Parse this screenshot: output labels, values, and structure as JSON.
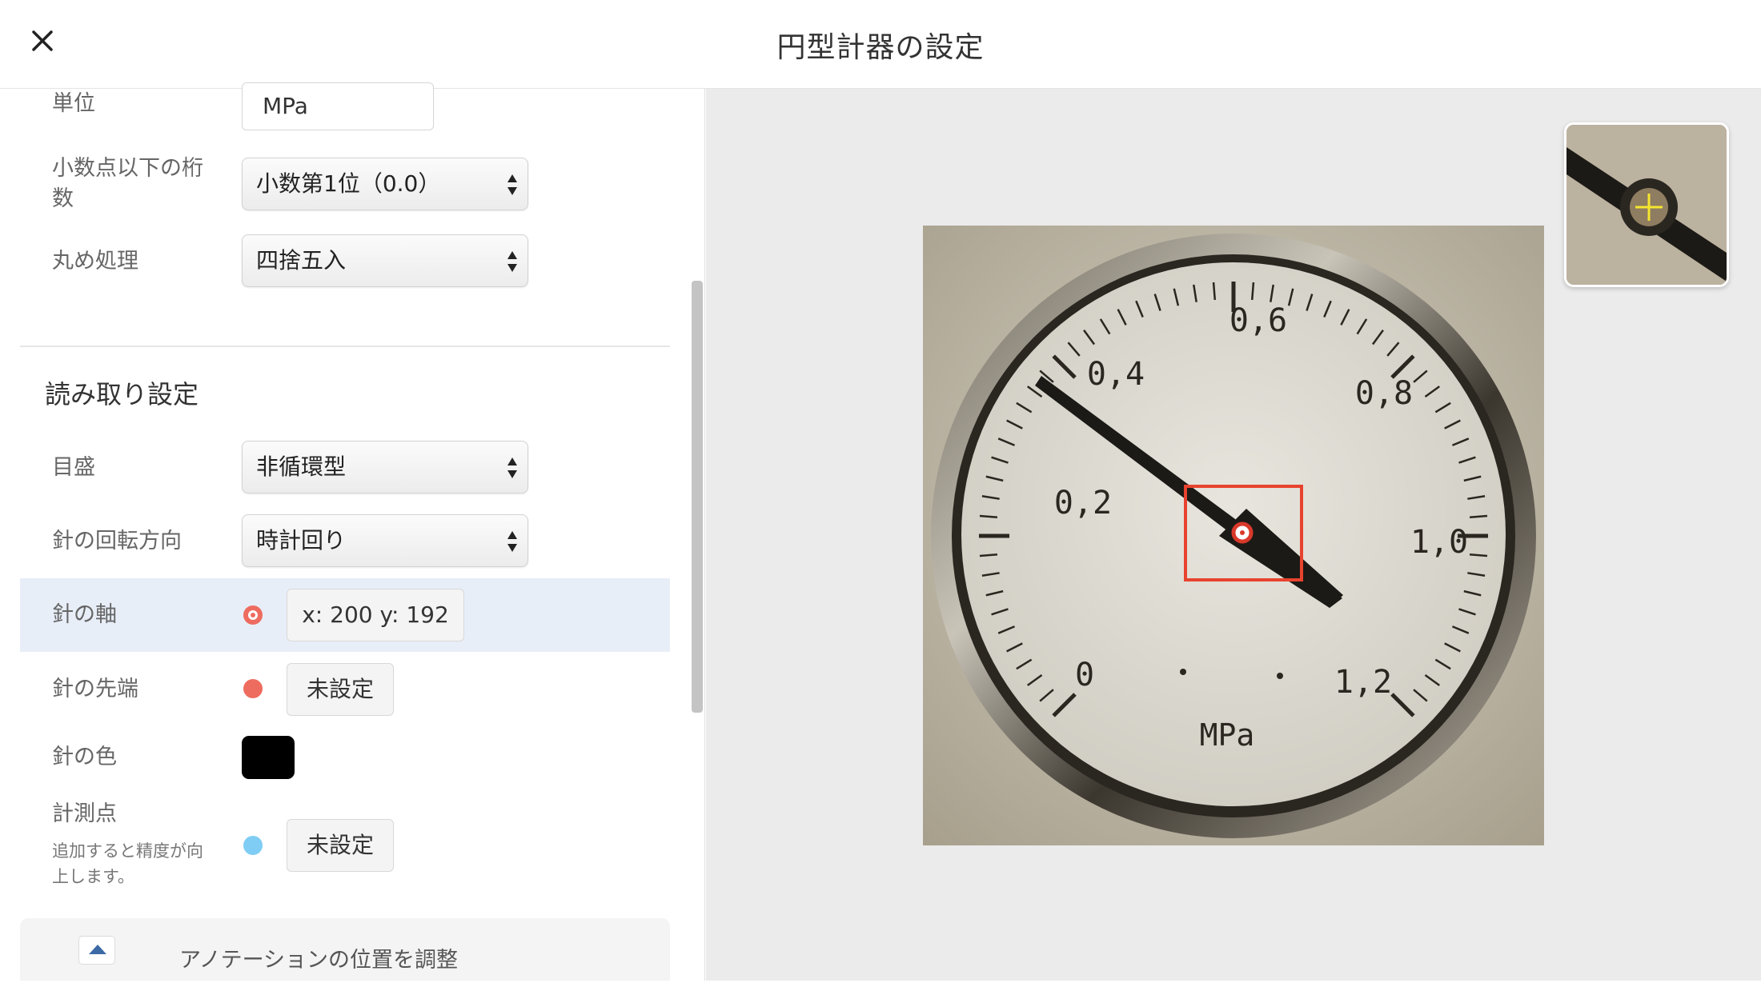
{
  "header": {
    "title": "円型計器の設定",
    "close_icon": "close-icon"
  },
  "settings": {
    "unit": {
      "label": "単位",
      "value": "MPa"
    },
    "decimals": {
      "label_line1": "小数点以下の桁",
      "label_line2": "数",
      "selected": "小数第1位（0.0）"
    },
    "rounding": {
      "label": "丸め処理",
      "selected": "四捨五入"
    }
  },
  "reading": {
    "section_title": "読み取り設定",
    "scale": {
      "label": "目盛",
      "selected": "非循環型"
    },
    "rotation": {
      "label": "針の回転方向",
      "selected": "時計回り"
    },
    "axis": {
      "label": "針の軸",
      "value": "x: 200 y: 192"
    },
    "tip": {
      "label": "針の先端",
      "button": "未設定"
    },
    "color": {
      "label": "針の色",
      "value": "#000000"
    },
    "points": {
      "label": "計測点",
      "hint_line1": "追加すると精度が向",
      "hint_line2": "上します。",
      "button": "未設定"
    }
  },
  "annotation": {
    "label": "アノテーションの位置を調整"
  },
  "gauge": {
    "unit_text": "MPa",
    "scale_labels": [
      "0",
      "0,2",
      "0,4",
      "0,6",
      "0,8",
      "1,0",
      "1,2"
    ]
  },
  "colors": {
    "marker_red": "#ee6c5f",
    "marker_blue": "#7fcdf4",
    "highlight": "#e8eef8",
    "selection_box": "#e8432e"
  }
}
